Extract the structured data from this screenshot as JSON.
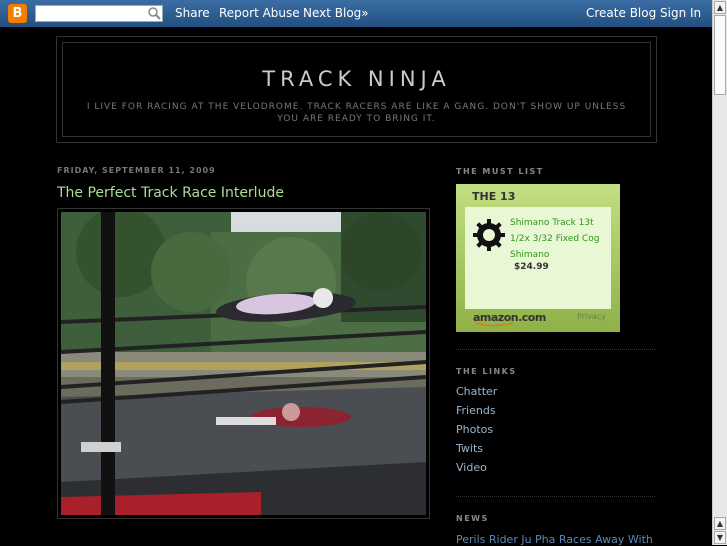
{
  "navbar": {
    "share": "Share",
    "report_abuse": "Report Abuse",
    "next_blog": "Next Blog»",
    "create_blog": "Create Blog",
    "sign_in": "Sign In",
    "search_value": ""
  },
  "header": {
    "title": "TRACK NINJA",
    "description": "I live for racing at the Velodrome. Track racers are like a gang. Don't show up unless you are ready to bring it."
  },
  "post": {
    "date": "Friday, September 11, 2009",
    "title": "The Perfect Track Race Interlude"
  },
  "sidebar": {
    "must_list_heading": "The Must List",
    "widget": {
      "heading": "THE 13",
      "product_name": "Shimano Track 13t 1/2x 3/32 Fixed Cog Shimano",
      "price": "$24.99",
      "amazon_logo": "amazon.com",
      "privacy": "Privacy"
    },
    "links_heading": "The Links",
    "links": [
      "Chatter",
      "Friends",
      "Photos",
      "Twits",
      "Video"
    ],
    "news_heading": "News",
    "news_first": "Perils Rider Ju Pha Races Away With"
  },
  "colors": {
    "navbar": "#2d5f93",
    "post_title": "#aadd99",
    "link": "#9ab5cc",
    "widget_green": "#9cbf5e"
  }
}
